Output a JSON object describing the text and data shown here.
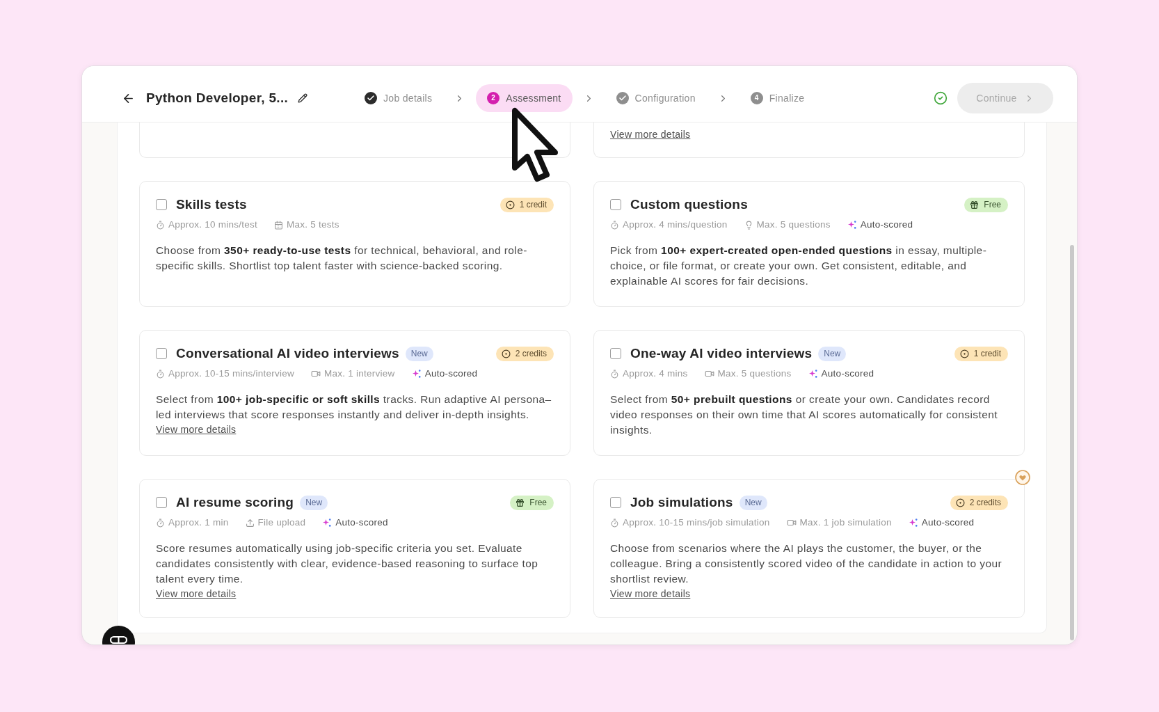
{
  "header": {
    "title": "Python Developer, 5...",
    "steps": [
      {
        "label": "Job details",
        "kind": "check",
        "disabled": false,
        "selected": false
      },
      {
        "label": "Assessment",
        "kind": "number",
        "number": "2",
        "disabled": false,
        "selected": true
      },
      {
        "label": "Configuration",
        "kind": "check",
        "disabled": true,
        "selected": false
      },
      {
        "label": "Finalize",
        "kind": "number",
        "number": "4",
        "disabled": true,
        "selected": false
      }
    ],
    "saved": true,
    "continue_button": {
      "label": "Continue",
      "disabled": true
    }
  },
  "cut_off_cards": [
    {
      "kind": "blank"
    },
    {
      "kind": "link",
      "link": "View more details"
    }
  ],
  "cards": [
    {
      "title": "Skills tests",
      "checked": false,
      "price": {
        "kind": "credit",
        "label": "1 credit"
      },
      "meta": [
        {
          "kind": "duration",
          "text": "Approx. 10 mins/test"
        },
        {
          "kind": "tests",
          "text": "Max. 5 tests"
        }
      ],
      "description": "Choose from **350+ ready-to-use tests** for technical, behavioral, and role-specific skills. Shortlist top talent faster with science-backed scoring."
    },
    {
      "title": "Custom questions",
      "checked": false,
      "price": {
        "kind": "free",
        "label": "Free"
      },
      "meta": [
        {
          "kind": "duration",
          "text": "Approx. 4 mins/question"
        },
        {
          "kind": "questions",
          "text": "Max. 5 questions"
        },
        {
          "kind": "auto",
          "text": "Auto-scored"
        }
      ],
      "description": "Pick from **100+ expert-created open-ended questions** in essay, multiple-choice, or file format, or create your own. Get consistent, editable, and explainable AI scores for fair decisions."
    },
    {
      "title": "Conversational AI video interviews",
      "new_tag": "New",
      "checked": false,
      "price": {
        "kind": "credit",
        "label": "2 credits"
      },
      "meta": [
        {
          "kind": "duration",
          "text": "Approx. 10-15 mins/interview"
        },
        {
          "kind": "video",
          "text": "Max. 1 interview"
        },
        {
          "kind": "auto",
          "text": "Auto-scored"
        }
      ],
      "description": "Select from **100+ job-specific or soft skills** tracks. Run adaptive AI persona–led interviews that score responses instantly and deliver in-depth insights.",
      "link": "View more details"
    },
    {
      "title": "One-way AI video interviews",
      "new_tag": "New",
      "checked": false,
      "price": {
        "kind": "credit",
        "label": "1 credit"
      },
      "meta": [
        {
          "kind": "duration",
          "text": "Approx. 4 mins"
        },
        {
          "kind": "video",
          "text": "Max. 5 questions"
        },
        {
          "kind": "auto",
          "text": "Auto-scored"
        }
      ],
      "description": "Select from **50+ prebuilt questions** or create your own. Candidates record video responses on their own time that AI scores automatically for consistent insights."
    },
    {
      "title": "AI resume scoring",
      "new_tag": "New",
      "checked": false,
      "price": {
        "kind": "free",
        "label": "Free"
      },
      "meta": [
        {
          "kind": "duration",
          "text": "Approx. 1 min"
        },
        {
          "kind": "upload",
          "text": "File upload"
        },
        {
          "kind": "auto",
          "text": "Auto-scored"
        }
      ],
      "description": "Score resumes automatically using job-specific criteria you set. Evaluate candidates consistently with clear, evidence-based reasoning to surface top talent every time.",
      "link": "View more details"
    },
    {
      "title": "Job simulations",
      "new_tag": "New",
      "checked": false,
      "price": {
        "kind": "credit",
        "label": "2 credits"
      },
      "meta": [
        {
          "kind": "duration",
          "text": "Approx. 10-15 mins/job simulation"
        },
        {
          "kind": "video",
          "text": "Max. 1 job simulation"
        },
        {
          "kind": "auto",
          "text": "Auto-scored"
        }
      ],
      "description": "Choose from scenarios where the AI plays the customer, the buyer, or the colleague. Bring a consistently scored video of the candidate in action to your shortlist review.",
      "link": "View more details"
    }
  ]
}
